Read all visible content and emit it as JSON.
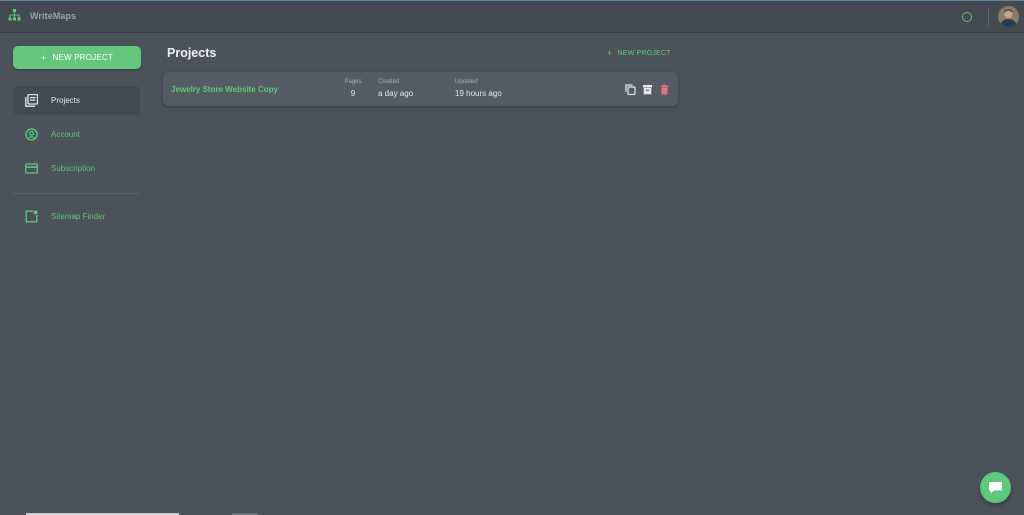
{
  "app": {
    "title": "WriteMaps",
    "accent": "#5cc97b"
  },
  "sidebar": {
    "new_project_label": "NEW PROJECT",
    "items": [
      {
        "label": "Projects",
        "icon": "projects-icon",
        "active": true
      },
      {
        "label": "Account",
        "icon": "account-icon",
        "active": false
      },
      {
        "label": "Subscription",
        "icon": "subscription-icon",
        "active": false
      },
      {
        "label": "Sitemap Finder",
        "icon": "sitemap-finder-icon",
        "active": false
      }
    ]
  },
  "main": {
    "title": "Projects",
    "new_project_label": "NEW PROJECT",
    "projects": [
      {
        "name": "Jewelry Store Website Copy",
        "pages_label": "Pages",
        "pages": "9",
        "created_label": "Created",
        "created": "a day ago",
        "updated_label": "Updated",
        "updated": "19 hours ago",
        "actions": [
          "copy-icon",
          "archive-icon",
          "delete-icon"
        ]
      }
    ]
  }
}
